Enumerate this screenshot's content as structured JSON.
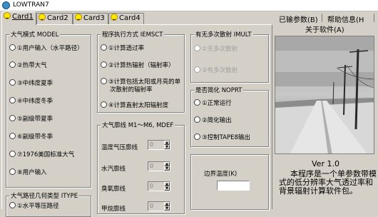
{
  "window": {
    "title": "LOWTRAN7"
  },
  "tabs": [
    {
      "label": "Card1",
      "active": true
    },
    {
      "label": "Card2",
      "active": false
    },
    {
      "label": "Card3",
      "active": false
    },
    {
      "label": "Card4",
      "active": false
    }
  ],
  "atmosphere_model": {
    "title": "大气模式 MODEL",
    "options": [
      {
        "label": "①用户输入（水平路径）",
        "checked": false
      },
      {
        "label": "②热带大气",
        "checked": false
      },
      {
        "label": "③中纬度夏季",
        "checked": false
      },
      {
        "label": "④中纬度冬季",
        "checked": false
      },
      {
        "label": "⑤副级带夏季",
        "checked": false
      },
      {
        "label": "⑥副级带冬季",
        "checked": false
      },
      {
        "label": "⑦1976美国标准大气",
        "checked": false
      },
      {
        "label": "⑧用户输入",
        "checked": false
      }
    ]
  },
  "path_geometry": {
    "title": "大气路径几何类型 ITYPE",
    "options": [
      {
        "label": "①水平等压路径",
        "checked": false
      }
    ]
  },
  "execution_mode": {
    "title": "程序执行方式 IEMSCT",
    "options": [
      {
        "label": "①计算透过率",
        "checked": false
      },
      {
        "label": "②计算热辐射（辐射率）",
        "checked": false
      },
      {
        "label": "③计算包括太阳或月亮的单次散射的辐射率",
        "checked": false
      },
      {
        "label": "④计算直射太阳辐射度",
        "checked": false
      }
    ]
  },
  "atmosphere_profile": {
    "title": "大气廓线 M1～M6, MDEF",
    "rows": [
      {
        "label": "温度气压廓线",
        "value": "0"
      },
      {
        "label": "水汽廓线",
        "value": "0"
      },
      {
        "label": "臭氧廓线",
        "value": "0"
      },
      {
        "label": "甲烷廓线",
        "value": "0"
      }
    ]
  },
  "multiple_scatter": {
    "title": "有无多次散射 IMULT",
    "options": [
      {
        "label": "①无多次散射",
        "checked": false,
        "disabled": true
      },
      {
        "label": "②有多次散射",
        "checked": false,
        "disabled": true
      }
    ]
  },
  "simplify": {
    "title": "是否简化 NOPRT",
    "options": [
      {
        "label": "①正常运行",
        "checked": false
      },
      {
        "label": "②简化输出",
        "checked": false
      },
      {
        "label": "③控制TAPE8输出",
        "checked": false
      }
    ]
  },
  "boundary": {
    "label": "边界温度(K)",
    "value": ""
  },
  "menu": {
    "items": [
      "已输参数(B)",
      "帮助信息(H"
    ],
    "about": "关于软件(A)"
  },
  "about_panel": {
    "version": "Ver 1.0",
    "description": "本程序是一个单参数带模式的低分辨率大气透过率和背景辐射计算软件包。"
  }
}
